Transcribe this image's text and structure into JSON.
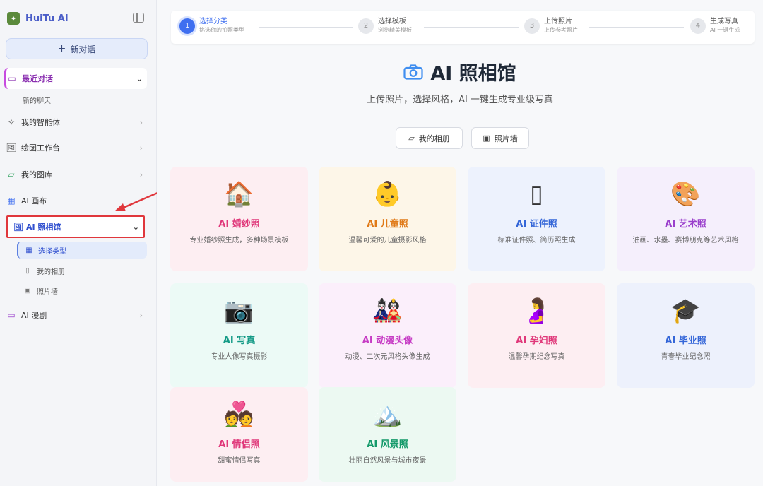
{
  "sidebar": {
    "brand": "HuiTu AI",
    "new_chat": "新对话",
    "recent": "最近对话",
    "recent_sub": "新的聊天",
    "agents": "我的智能体",
    "workspace": "绘图工作台",
    "gallery": "我的图库",
    "canvas": "AI 画布",
    "photo_studio": "AI 照相馆",
    "sub_items": [
      "选择类型",
      "我的相册",
      "照片墙"
    ],
    "comic": "AI 漫剧"
  },
  "steps": [
    {
      "num": "1",
      "title": "选择分类",
      "desc": "挑选你的拍照类型"
    },
    {
      "num": "2",
      "title": "选择模板",
      "desc": "浏览精美模板"
    },
    {
      "num": "3",
      "title": "上传照片",
      "desc": "上传参考照片"
    },
    {
      "num": "4",
      "title": "生成写真",
      "desc": "AI 一键生成"
    }
  ],
  "hero": {
    "title": "AI 照相馆",
    "subtitle": "上传照片，选择风格，AI 一键生成专业级写真"
  },
  "actions": {
    "album": "我的相册",
    "wall": "照片墙"
  },
  "cards": [
    {
      "icon": "🏠",
      "title": "AI 婚纱照",
      "desc": "专业婚纱照生成，多种场景模板",
      "color": "#e0387a",
      "bg": "#fdeef2"
    },
    {
      "icon": "👶",
      "title": "AI 儿童照",
      "desc": "温馨可爱的儿童摄影风格",
      "color": "#e07a18",
      "bg": "#fdf6e8"
    },
    {
      "icon": "▯",
      "title": "AI 证件照",
      "desc": "标准证件照、简历照生成",
      "color": "#3466d8",
      "bg": "#edf2fd"
    },
    {
      "icon": "🎨",
      "title": "AI 艺术照",
      "desc": "油画、水墨、赛博朋克等艺术风格",
      "color": "#9a3fcc",
      "bg": "#f5effc"
    },
    {
      "icon": "📷",
      "title": "AI 写真",
      "desc": "专业人像写真摄影",
      "color": "#149a86",
      "bg": "#ecfaf6"
    },
    {
      "icon": "🎎",
      "title": "AI 动漫头像",
      "desc": "动漫、二次元风格头像生成",
      "color": "#c63bc4",
      "bg": "#fbeffb"
    },
    {
      "icon": "🤰",
      "title": "AI 孕妇照",
      "desc": "温馨孕期纪念写真",
      "color": "#e0387a",
      "bg": "#fdeef2"
    },
    {
      "icon": "🎓",
      "title": "AI 毕业照",
      "desc": "青春毕业纪念照",
      "color": "#3466d8",
      "bg": "#edf1fc"
    },
    {
      "icon": "💑",
      "title": "AI 情侣照",
      "desc": "甜蜜情侣写真",
      "color": "#e0387a",
      "bg": "#fdeef2"
    },
    {
      "icon": "🏔️",
      "title": "AI 风景照",
      "desc": "壮丽自然风景与城市夜景",
      "color": "#149a6a",
      "bg": "#ecf9f2"
    }
  ],
  "icons": {
    "collapse": "sidebar-collapse-icon",
    "plus": "plus-icon",
    "chat": "chat-icon",
    "agents": "sparkle-icon",
    "workspace": "image-icon",
    "gallery": "folder-icon",
    "canvas": "grid-icon",
    "photo": "image-icon",
    "comic": "video-icon",
    "camera": "camera-icon"
  }
}
